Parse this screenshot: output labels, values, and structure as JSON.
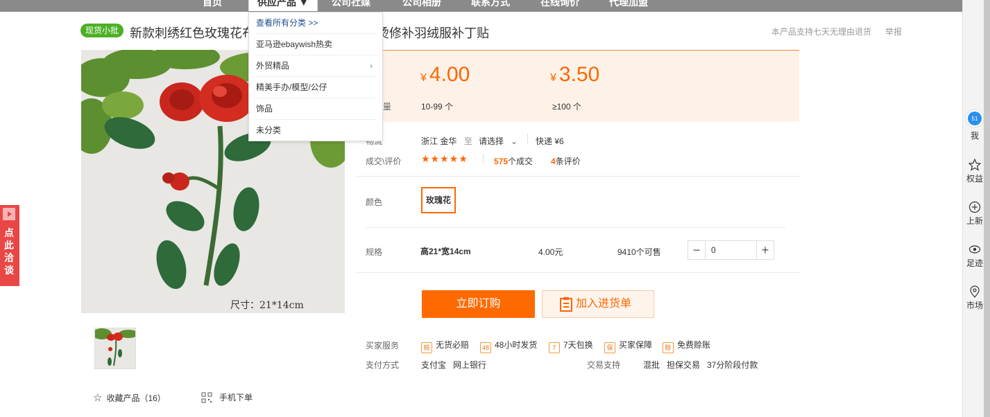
{
  "nav": {
    "items": [
      "首页",
      "供应产品 ▼",
      "公司社媒",
      "公司相册",
      "联系方式",
      "在线询价",
      "代理加盟"
    ]
  },
  "dropdown": {
    "items": [
      "查看所有分类 >>",
      "亚马逊ebaywish热卖",
      "外贸精品",
      "精美手办/模型/公仔",
      "饰品",
      "未分类"
    ]
  },
  "product": {
    "badge": "现货小批",
    "title_head": "新款刺绣红色玫瑰花布",
    "title_tail": "烫修补羽绒服补丁贴",
    "support": "本产品支持七天无理由退货",
    "report": "举报",
    "image_caption": "尺寸：21*14cm"
  },
  "price": {
    "tiers": [
      {
        "currency": "¥",
        "value": "4.00",
        "range": "10-99 个"
      },
      {
        "currency": "¥",
        "value": "3.50",
        "range": "≥100 个"
      }
    ],
    "label_partial": "量"
  },
  "logistics": {
    "label_partial": "物流",
    "from": "浙江 金华",
    "to_word": "至",
    "to_select": "请选择",
    "express": "快递 ¥6"
  },
  "deals": {
    "label": "成交\\评价",
    "rating": 5,
    "count_num": "575",
    "count_text": "个成交",
    "reviews_num": "4",
    "reviews_text": "条评价"
  },
  "color": {
    "label": "颜色",
    "option": "玫瑰花"
  },
  "spec": {
    "label": "规格",
    "name": "高21*宽14cm",
    "price": "4.00元",
    "stock": "9410个可售",
    "qty": "0",
    "minus": "−",
    "plus": "+"
  },
  "actions": {
    "order": "立即订购",
    "cart": "加入进货单"
  },
  "services": {
    "label": "买家服务",
    "items": [
      {
        "icon": "赔",
        "text": "无货必赔"
      },
      {
        "icon": "48",
        "text": "48小时发货"
      },
      {
        "icon": "7",
        "text": "7天包换"
      },
      {
        "icon": "保",
        "text": "买家保障"
      },
      {
        "icon": "赊",
        "text": "免费赊账"
      }
    ]
  },
  "payment": {
    "label": "支付方式",
    "methods": "支付宝   网上银行",
    "trade_label": "交易支持",
    "trade_items": "混批   担保交易   37分阶段付款"
  },
  "gallery": {
    "favorite": "收藏产品（16）",
    "mobile": "手机下单"
  },
  "right_toolbar": {
    "items": [
      "我",
      "权益",
      "上新",
      "足迹",
      "市场"
    ],
    "bubble": "51"
  },
  "chat": {
    "label": "点此洽谈"
  },
  "colors": {
    "accent": "#ff6a00",
    "badge_green": "#4caf25",
    "chat_red": "#e94646",
    "nav_gray": "#8a8a8a"
  }
}
